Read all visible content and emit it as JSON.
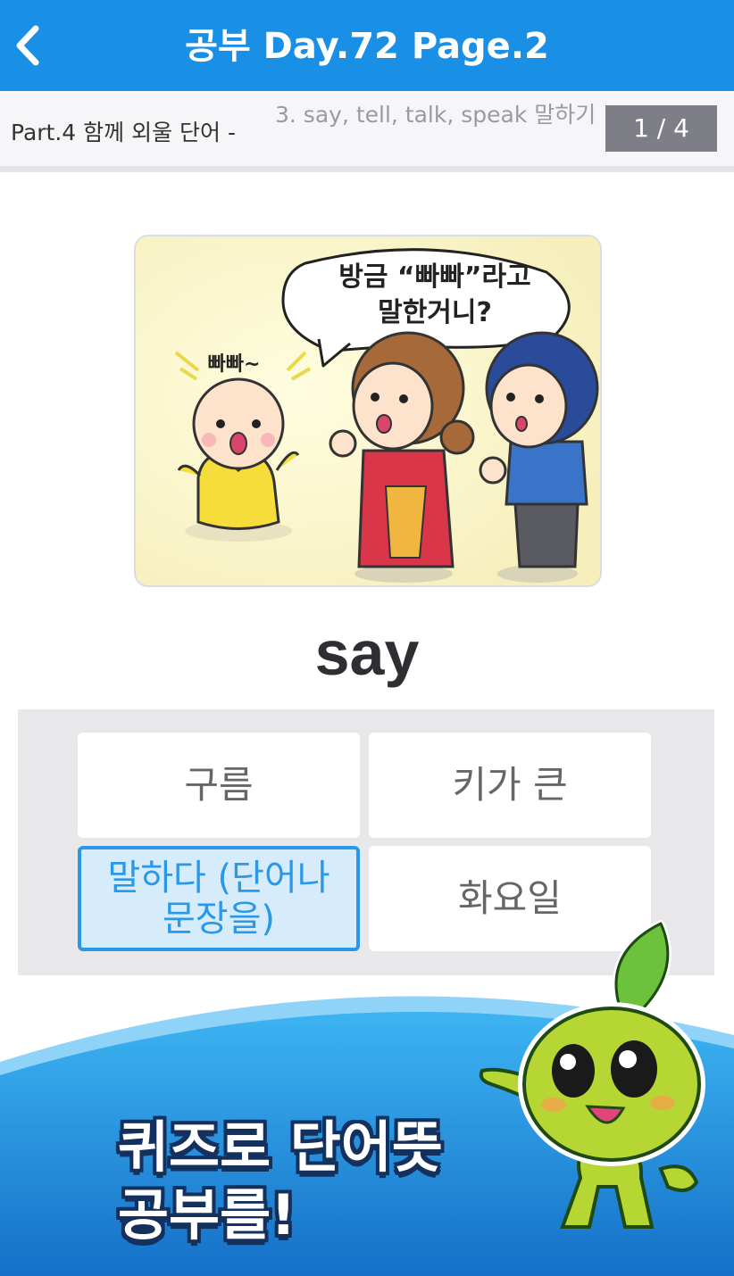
{
  "header": {
    "title": "공부 Day.72 Page.2",
    "back_icon": "chevron-left-icon"
  },
  "subheader": {
    "part_label": "Part.4 함께 외울 단어 -",
    "part_desc": "3. say, tell, talk, speak 말하기",
    "page_counter": "1 / 4"
  },
  "illustration": {
    "speech_bubble": "방금 “빠빠”라고\n말한거니?",
    "baby_sound": "빠빠~"
  },
  "quiz": {
    "word": "say",
    "choices": [
      {
        "label": "구름",
        "selected": false
      },
      {
        "label": "키가 큰",
        "selected": false
      },
      {
        "label": "말하다 (단어나 문장을)",
        "selected": true
      },
      {
        "label": "화요일",
        "selected": false
      }
    ]
  },
  "promo": {
    "line1": "퀴즈로 단어뜻",
    "line2": "공부를!"
  },
  "colors": {
    "primary": "#1a8fe6",
    "selected_bg": "#d6ecfb",
    "selected_border": "#2a98e8"
  }
}
